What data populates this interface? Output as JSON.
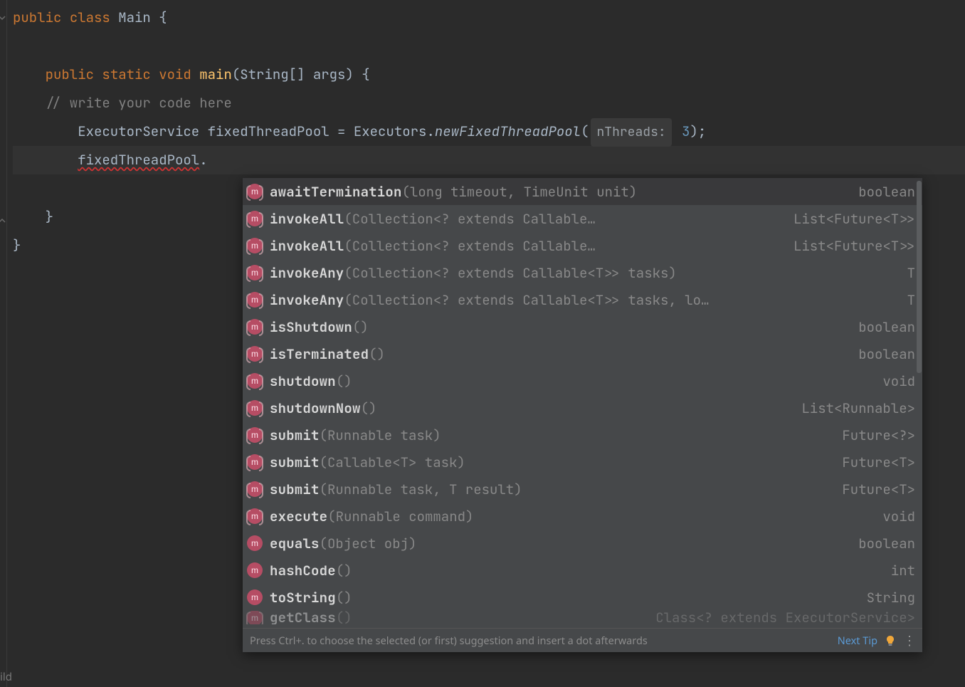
{
  "code": {
    "class_decl": {
      "public": "public",
      "class": "class",
      "name": "Main",
      "brace": "{"
    },
    "method_decl": {
      "public": "public",
      "static": "static",
      "void": "void",
      "name": "main",
      "params": "(String[] args)",
      "brace": "{"
    },
    "comment": "// write your code here",
    "line_exec": {
      "type": "ExecutorService",
      "var": "fixedThreadPool",
      "eq": "=",
      "factory": "Executors.",
      "method": "newFixedThreadPool",
      "open": "(",
      "hint": "nThreads:",
      "arg": "3",
      "close": ");"
    },
    "cursor_line": {
      "expr": "fixedThreadPool",
      "dot": "."
    },
    "close_method": "}",
    "close_class": "}"
  },
  "popup": {
    "items": [
      {
        "icon": "paren",
        "name": "awaitTermination",
        "params": "(long timeout, TimeUnit unit)",
        "ret": "boolean"
      },
      {
        "icon": "paren",
        "name": "invokeAll",
        "params": "(Collection<? extends Callable…",
        "ret": "List<Future<T>>"
      },
      {
        "icon": "paren",
        "name": "invokeAll",
        "params": "(Collection<? extends Callable…",
        "ret": "List<Future<T>>"
      },
      {
        "icon": "paren",
        "name": "invokeAny",
        "params": "(Collection<? extends Callable<T>> tasks)",
        "ret": "T"
      },
      {
        "icon": "paren",
        "name": "invokeAny",
        "params": "(Collection<? extends Callable<T>> tasks, lo…",
        "ret": "T"
      },
      {
        "icon": "paren",
        "name": "isShutdown",
        "params": "()",
        "ret": "boolean"
      },
      {
        "icon": "paren",
        "name": "isTerminated",
        "params": "()",
        "ret": "boolean"
      },
      {
        "icon": "paren",
        "name": "shutdown",
        "params": "()",
        "ret": "void"
      },
      {
        "icon": "paren",
        "name": "shutdownNow",
        "params": "()",
        "ret": "List<Runnable>"
      },
      {
        "icon": "paren",
        "name": "submit",
        "params": "(Runnable task)",
        "ret": "Future<?>"
      },
      {
        "icon": "paren",
        "name": "submit",
        "params": "(Callable<T> task)",
        "ret": "Future<T>"
      },
      {
        "icon": "paren",
        "name": "submit",
        "params": "(Runnable task, T result)",
        "ret": "Future<T>"
      },
      {
        "icon": "paren",
        "name": "execute",
        "params": "(Runnable command)",
        "ret": "void"
      },
      {
        "icon": "plain",
        "name": "equals",
        "params": "(Object obj)",
        "ret": "boolean"
      },
      {
        "icon": "plain",
        "name": "hashCode",
        "params": "()",
        "ret": "int"
      },
      {
        "icon": "plain",
        "name": "toString",
        "params": "()",
        "ret": "String"
      },
      {
        "icon": "paren",
        "name": "getClass",
        "params": "()",
        "ret": "Class<? extends ExecutorService>",
        "cut": true
      }
    ],
    "footer": {
      "tip": "Press Ctrl+. to choose the selected (or first) suggestion and insert a dot afterwards",
      "next_tip": "Next Tip"
    }
  },
  "status": {
    "left": "ild"
  }
}
